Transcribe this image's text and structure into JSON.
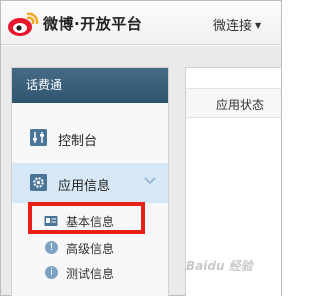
{
  "header": {
    "brand_title": "微博·开放平台",
    "link_menu_label": "微连接"
  },
  "sidebar": {
    "title": "话费通",
    "items": [
      {
        "label": "控制台",
        "icon": "sliders-icon"
      },
      {
        "label": "应用信息",
        "icon": "gear-icon",
        "expanded": true
      }
    ],
    "sub_items": [
      {
        "label": "基本信息",
        "icon": "id-card-icon",
        "highlighted": true
      },
      {
        "label": "高级信息",
        "icon": "info-icon"
      },
      {
        "label": "测试信息",
        "icon": "info-icon"
      }
    ]
  },
  "main": {
    "status_label": "应用状态"
  },
  "colors": {
    "sidebar_header": "#35597a",
    "active_item": "#d6e8f5",
    "highlight_box": "#e8201a",
    "icon_blue": "#4a7498"
  }
}
